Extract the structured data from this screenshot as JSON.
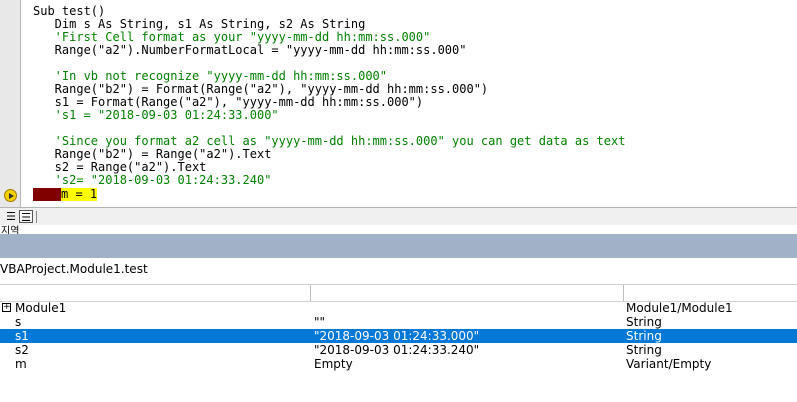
{
  "code": {
    "lines": [
      {
        "text": "Sub test()",
        "kind": "code"
      },
      {
        "text": "    Dim s As String, s1 As String, s2 As String",
        "kind": "code"
      },
      {
        "text": "    'First Cell format as your \"yyyy-mm-dd hh:mm:ss.000\"",
        "kind": "comment"
      },
      {
        "text": "    Range(\"a2\").NumberFormatLocal = \"yyyy-mm-dd hh:mm:ss.000\"",
        "kind": "code"
      },
      {
        "text": "",
        "kind": "code"
      },
      {
        "text": "    'In vb not recognize \"yyyy-mm-dd hh:mm:ss.000\"",
        "kind": "comment"
      },
      {
        "text": "    Range(\"b2\") = Format(Range(\"a2\"), \"yyyy-mm-dd hh:mm:ss.000\")",
        "kind": "code"
      },
      {
        "text": "    s1 = Format(Range(\"a2\"), \"yyyy-mm-dd hh:mm:ss.000\")",
        "kind": "code"
      },
      {
        "text": "    's1 = \"2018-09-03 01:24:33.000\"",
        "kind": "comment"
      },
      {
        "text": "",
        "kind": "code"
      },
      {
        "text": "    'Since you format a2 cell as \"yyyy-mm-dd hh:mm:ss.000\" you can get data as text",
        "kind": "comment"
      },
      {
        "text": "    Range(\"b2\") = Range(\"a2\").Text",
        "kind": "code"
      },
      {
        "text": "    s2 = Range(\"a2\").Text",
        "kind": "code"
      },
      {
        "text": "    's2= \"2018-09-03 01:24:33.240\"",
        "kind": "comment"
      }
    ],
    "current_line": "m = 1"
  },
  "locals": {
    "window_title": "지역",
    "context": "VBAProject.Module1.test",
    "rows": [
      {
        "expression": "Module1",
        "value": "",
        "type": "Module1/Module1",
        "expandable": true,
        "selected": false
      },
      {
        "expression": "s",
        "value": "\"\"",
        "type": "String",
        "expandable": false,
        "selected": false
      },
      {
        "expression": "s1",
        "value": "\"2018-09-03 01:24:33.000\"",
        "type": "String",
        "expandable": false,
        "selected": true
      },
      {
        "expression": "s2",
        "value": "\"2018-09-03 01:24:33.240\"",
        "type": "String",
        "expandable": false,
        "selected": false
      },
      {
        "expression": "m",
        "value": "Empty",
        "type": "Variant/Empty",
        "expandable": false,
        "selected": false
      }
    ]
  },
  "icons": {
    "execution": "execution-point-arrow-icon",
    "view_full": "full-module-view-icon",
    "view_proc": "procedure-view-icon",
    "expand": "expand-plus-icon"
  }
}
